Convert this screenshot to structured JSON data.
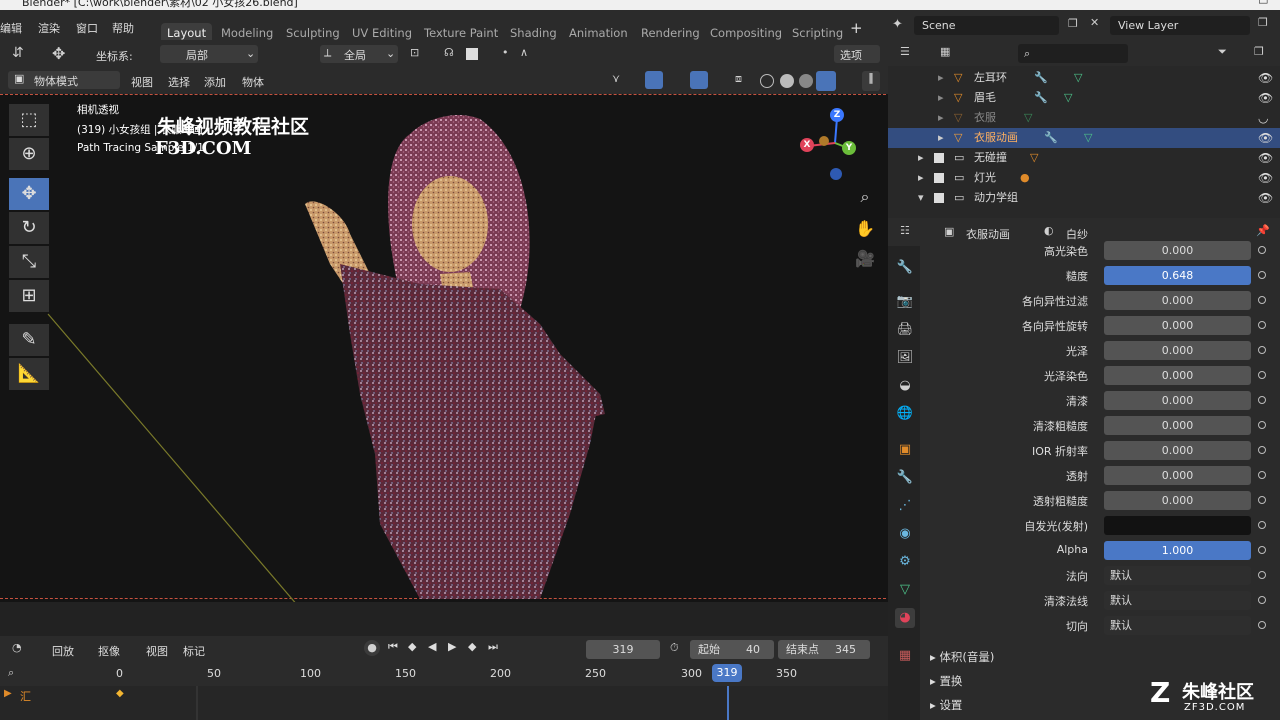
{
  "title_bar": {
    "text": "Blender* [C:\\work\\blender\\素材\\02 小女孩26.blend]"
  },
  "menu": [
    "编辑",
    "渲染",
    "窗口",
    "帮助"
  ],
  "workspace_tabs": [
    "Layout",
    "Modeling",
    "Sculpting",
    "UV Editing",
    "Texture Paint",
    "Shading",
    "Animation",
    "Rendering",
    "Compositing",
    "Scripting"
  ],
  "scene": {
    "scene_label": "Scene",
    "view_layer_label": "View Layer"
  },
  "viewport_header": {
    "coord_label": "坐标系:",
    "coord_value": "局部",
    "pivot_value": "全局",
    "options_label": "选项",
    "mode_label": "物体模式",
    "view": "视图",
    "select": "选择",
    "add": "添加",
    "object": "物体"
  },
  "overlay_text": {
    "line1": "相机透视",
    "line2": "(319) 小女孩组 | 衣服动画",
    "line3": "Path Tracing Sample 1/1",
    "watermark_cn": "朱峰视频教程社区",
    "watermark_en": "F3D.COM"
  },
  "gizmo": {
    "z": "Z",
    "y": "Y",
    "x": "X"
  },
  "timeline": {
    "playback": "回放",
    "keying": "抠像",
    "view": "视图",
    "marker": "标记",
    "current_frame": "319",
    "start_label": "起始",
    "start_value": "40",
    "end_label": "结束点",
    "end_value": "345",
    "ruler": [
      "0",
      "50",
      "100",
      "150",
      "200",
      "250",
      "300",
      "319",
      "350"
    ],
    "track_label": "汇"
  },
  "outliner": [
    {
      "label": "左耳环",
      "indent": 2,
      "highlight": false,
      "dim": false
    },
    {
      "label": "眉毛",
      "indent": 2,
      "highlight": false,
      "dim": false
    },
    {
      "label": "衣服",
      "indent": 2,
      "highlight": false,
      "dim": true
    },
    {
      "label": "衣服动画",
      "indent": 2,
      "highlight": true,
      "dim": false
    },
    {
      "label": "无碰撞",
      "indent": 1,
      "highlight": false,
      "dim": false
    },
    {
      "label": "灯光",
      "indent": 1,
      "highlight": false,
      "dim": false
    },
    {
      "label": "动力学组",
      "indent": 1,
      "highlight": false,
      "dim": false
    }
  ],
  "properties_header": {
    "object": "衣服动画",
    "material": "白纱"
  },
  "properties": [
    {
      "label": "高光染色",
      "value": "0.000",
      "style": "num"
    },
    {
      "label": "糙度",
      "value": "0.648",
      "style": "blue"
    },
    {
      "label": "各向异性过滤",
      "value": "0.000",
      "style": "num"
    },
    {
      "label": "各向异性旋转",
      "value": "0.000",
      "style": "num"
    },
    {
      "label": "光泽",
      "value": "0.000",
      "style": "num"
    },
    {
      "label": "光泽染色",
      "value": "0.000",
      "style": "num"
    },
    {
      "label": "清漆",
      "value": "0.000",
      "style": "num"
    },
    {
      "label": "清漆粗糙度",
      "value": "0.000",
      "style": "num"
    },
    {
      "label": "IOR 折射率",
      "value": "0.000",
      "style": "num"
    },
    {
      "label": "透射",
      "value": "0.000",
      "style": "num"
    },
    {
      "label": "透射粗糙度",
      "value": "0.000",
      "style": "num"
    },
    {
      "label": "自发光(发射)",
      "value": "",
      "style": "black"
    },
    {
      "label": "Alpha",
      "value": "1.000",
      "style": "blue"
    },
    {
      "label": "法向",
      "value": "默认",
      "style": "left"
    },
    {
      "label": "清漆法线",
      "value": "默认",
      "style": "left"
    },
    {
      "label": "切向",
      "value": "默认",
      "style": "left"
    }
  ],
  "sections": [
    "体积(音量)",
    "置换",
    "设置"
  ],
  "corner_watermark": {
    "cn": "朱峰社区",
    "en": "ZF3D.COM"
  }
}
